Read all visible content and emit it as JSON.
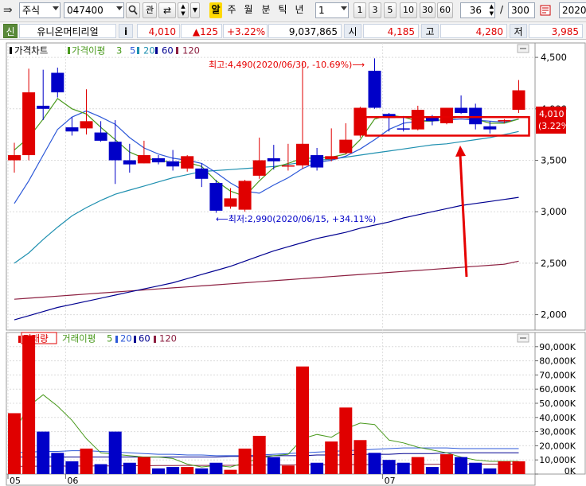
{
  "toolbar": {
    "market_select": "주식",
    "code_input": "047400",
    "btn_gwan": "관",
    "btn_al": "알",
    "period_tabs": [
      "주",
      "월",
      "분",
      "틱",
      "년"
    ],
    "interval_select": "1",
    "quick_intervals": [
      "1",
      "3",
      "5",
      "10",
      "30",
      "60"
    ],
    "view_count": "36",
    "view_slash": "/",
    "total_count": "300",
    "date_field": "2020/"
  },
  "infobar": {
    "badge": "신",
    "stock_name": "유니온머티리얼",
    "info_btn": "i",
    "price": "4,010",
    "change": "▲125",
    "change_pct": "+3.22%",
    "volume": "9,037,865",
    "open_label": "시",
    "open": "4,185",
    "high_label": "고",
    "high": "4,280",
    "low_label": "저",
    "low": "3,985"
  },
  "colors": {
    "up": "#e00000",
    "down": "#0000c8",
    "ma3": "#4a9a1e",
    "ma5": "#2c58d8",
    "ma20": "#1f90b0",
    "ma60": "#000090",
    "ma120": "#8c1f40",
    "annotation": "#e60000"
  },
  "price_panel": {
    "legend": [
      {
        "text": "가격차트",
        "color": "#000000"
      },
      {
        "text": "가격이평",
        "color": "#4a9a1e"
      },
      {
        "text": "3",
        "color": "#4a9a1e"
      },
      {
        "text": "5",
        "color": "#2c58d8"
      },
      {
        "text": "20",
        "color": "#1f90b0"
      },
      {
        "text": "60",
        "color": "#000090"
      },
      {
        "text": "120",
        "color": "#8c1f40"
      }
    ],
    "high_annotation": "최고:4,490(2020/06/30, -10.69%)⟶",
    "low_annotation": "⟵최저:2,990(2020/06/15, +34.11%)",
    "price_tag": "4,010",
    "pct_tag": "(3.22%)"
  },
  "volume_panel": {
    "legend": [
      {
        "text": "거래량",
        "color": "#e00000"
      },
      {
        "text": "거래이평",
        "color": "#4a9a1e"
      },
      {
        "text": "5",
        "color": "#4a9a1e"
      },
      {
        "text": "20",
        "color": "#2c58d8"
      },
      {
        "text": "60",
        "color": "#000090"
      },
      {
        "text": "120",
        "color": "#8c1f40"
      }
    ]
  },
  "chart_data": {
    "type": "candlestick",
    "price_ticks": [
      "4,500",
      "4,000",
      "3,500",
      "3,000",
      "2,500",
      "2,000"
    ],
    "price_tick_values": [
      4500,
      4000,
      3500,
      3000,
      2500,
      2000
    ],
    "ylim": [
      1850,
      4640
    ],
    "volume_ticks": [
      "90,000K",
      "80,000K",
      "70,000K",
      "60,000K",
      "50,000K",
      "40,000K",
      "30,000K",
      "20,000K",
      "10,000K",
      "0K"
    ],
    "volume_tick_values": [
      90000,
      80000,
      70000,
      60000,
      50000,
      40000,
      30000,
      20000,
      10000,
      0
    ],
    "volume_ylim": [
      0,
      100000
    ],
    "x_labels": [
      {
        "i": 0,
        "label": "05"
      },
      {
        "i": 4,
        "label": "06"
      },
      {
        "i": 26,
        "label": "07"
      }
    ],
    "candles": [
      {
        "o": 3500,
        "h": 3670,
        "l": 3380,
        "c": 3550,
        "v": 43000
      },
      {
        "o": 3550,
        "h": 4390,
        "l": 3500,
        "c": 4160,
        "v": 98000
      },
      {
        "o": 4030,
        "h": 4380,
        "l": 3890,
        "c": 4000,
        "v": 30000
      },
      {
        "o": 4350,
        "h": 4400,
        "l": 4110,
        "c": 4160,
        "v": 15000
      },
      {
        "o": 3820,
        "h": 3920,
        "l": 3740,
        "c": 3780,
        "v": 9000
      },
      {
        "o": 3810,
        "h": 4190,
        "l": 3750,
        "c": 3880,
        "v": 18000
      },
      {
        "o": 3770,
        "h": 3880,
        "l": 3680,
        "c": 3690,
        "v": 7000
      },
      {
        "o": 3680,
        "h": 3890,
        "l": 3270,
        "c": 3500,
        "v": 30000
      },
      {
        "o": 3500,
        "h": 3660,
        "l": 3380,
        "c": 3460,
        "v": 8000
      },
      {
        "o": 3470,
        "h": 3690,
        "l": 3470,
        "c": 3550,
        "v": 12000
      },
      {
        "o": 3520,
        "h": 3550,
        "l": 3460,
        "c": 3480,
        "v": 4000
      },
      {
        "o": 3490,
        "h": 3600,
        "l": 3400,
        "c": 3440,
        "v": 5000
      },
      {
        "o": 3420,
        "h": 3550,
        "l": 3390,
        "c": 3540,
        "v": 5000
      },
      {
        "o": 3420,
        "h": 3470,
        "l": 3240,
        "c": 3320,
        "v": 4000
      },
      {
        "o": 3280,
        "h": 3310,
        "l": 2990,
        "c": 3010,
        "v": 8000
      },
      {
        "o": 3050,
        "h": 3230,
        "l": 3030,
        "c": 3130,
        "v": 3000
      },
      {
        "o": 3020,
        "h": 3310,
        "l": 3000,
        "c": 3300,
        "v": 18000
      },
      {
        "o": 3350,
        "h": 3720,
        "l": 3320,
        "c": 3500,
        "v": 27000
      },
      {
        "o": 3520,
        "h": 3650,
        "l": 3410,
        "c": 3490,
        "v": 12000
      },
      {
        "o": 3440,
        "h": 3660,
        "l": 3400,
        "c": 3450,
        "v": 6000
      },
      {
        "o": 3450,
        "h": 4460,
        "l": 3420,
        "c": 3660,
        "v": 76000
      },
      {
        "o": 3550,
        "h": 3620,
        "l": 3400,
        "c": 3430,
        "v": 8000
      },
      {
        "o": 3510,
        "h": 3810,
        "l": 3490,
        "c": 3540,
        "v": 23000
      },
      {
        "o": 3570,
        "h": 3860,
        "l": 3560,
        "c": 3700,
        "v": 47000
      },
      {
        "o": 3740,
        "h": 4020,
        "l": 3720,
        "c": 4010,
        "v": 24000
      },
      {
        "o": 4370,
        "h": 4490,
        "l": 4000,
        "c": 4010,
        "v": 15000
      },
      {
        "o": 3950,
        "h": 3960,
        "l": 3780,
        "c": 3910,
        "v": 10000
      },
      {
        "o": 3810,
        "h": 3930,
        "l": 3780,
        "c": 3800,
        "v": 8000
      },
      {
        "o": 3800,
        "h": 4030,
        "l": 3790,
        "c": 3990,
        "v": 12000
      },
      {
        "o": 3920,
        "h": 3940,
        "l": 3840,
        "c": 3880,
        "v": 5000
      },
      {
        "o": 3860,
        "h": 4010,
        "l": 3850,
        "c": 4010,
        "v": 14000
      },
      {
        "o": 4010,
        "h": 4130,
        "l": 3950,
        "c": 3960,
        "v": 12000
      },
      {
        "o": 4010,
        "h": 4050,
        "l": 3800,
        "c": 3850,
        "v": 8000
      },
      {
        "o": 3830,
        "h": 3880,
        "l": 3760,
        "c": 3800,
        "v": 4000
      },
      {
        "o": 3880,
        "h": 3900,
        "l": 3860,
        "c": 3890,
        "v": 9000
      },
      {
        "o": 3990,
        "h": 4280,
        "l": 3960,
        "c": 4180,
        "v": 9000
      }
    ],
    "ma": {
      "ma3": [
        3600,
        3720,
        3900,
        4100,
        4000,
        3950,
        3820,
        3700,
        3580,
        3520,
        3500,
        3480,
        3480,
        3440,
        3300,
        3200,
        3150,
        3300,
        3430,
        3470,
        3520,
        3520,
        3530,
        3560,
        3700,
        3900,
        3940,
        3920,
        3880,
        3880,
        3900,
        3920,
        3900,
        3860,
        3860,
        3900
      ],
      "ma5": [
        3080,
        3300,
        3550,
        3800,
        3920,
        3980,
        3920,
        3850,
        3720,
        3620,
        3560,
        3520,
        3500,
        3470,
        3380,
        3280,
        3200,
        3180,
        3260,
        3330,
        3420,
        3480,
        3500,
        3540,
        3610,
        3700,
        3800,
        3860,
        3880,
        3890,
        3890,
        3900,
        3890,
        3880,
        3870,
        3900
      ],
      "ma20": [
        2500,
        2600,
        2730,
        2850,
        2960,
        3040,
        3110,
        3170,
        3210,
        3250,
        3290,
        3330,
        3360,
        3390,
        3400,
        3410,
        3420,
        3430,
        3440,
        3460,
        3480,
        3500,
        3510,
        3530,
        3550,
        3570,
        3590,
        3610,
        3630,
        3650,
        3660,
        3680,
        3700,
        3720,
        3750,
        3780
      ],
      "ma60": [
        1950,
        1990,
        2030,
        2070,
        2100,
        2130,
        2160,
        2190,
        2220,
        2250,
        2280,
        2310,
        2350,
        2390,
        2430,
        2470,
        2520,
        2570,
        2620,
        2660,
        2700,
        2740,
        2770,
        2800,
        2840,
        2870,
        2900,
        2940,
        2970,
        3000,
        3030,
        3060,
        3080,
        3100,
        3120,
        3140
      ],
      "ma120": [
        2150,
        2160,
        2170,
        2180,
        2190,
        2200,
        2210,
        2220,
        2230,
        2240,
        2250,
        2260,
        2270,
        2280,
        2290,
        2300,
        2310,
        2320,
        2330,
        2340,
        2350,
        2360,
        2370,
        2380,
        2390,
        2400,
        2410,
        2420,
        2430,
        2440,
        2450,
        2460,
        2470,
        2480,
        2490,
        2520
      ]
    },
    "vma": {
      "vma5": [
        30000,
        48000,
        56000,
        48000,
        38000,
        25000,
        15000,
        14000,
        13000,
        12000,
        12000,
        11000,
        7000,
        5000,
        6000,
        5000,
        8000,
        11000,
        13000,
        14000,
        25000,
        28000,
        26000,
        32000,
        36000,
        35000,
        24000,
        22000,
        19000,
        17000,
        15000,
        12000,
        10000,
        9000,
        9000,
        9000
      ],
      "vma20": [
        15000,
        15500,
        16000,
        16000,
        16500,
        16500,
        16000,
        15500,
        15000,
        14500,
        14000,
        14000,
        13500,
        13500,
        13000,
        13000,
        13000,
        13500,
        14000,
        14500,
        15000,
        15500,
        16000,
        16500,
        17000,
        17500,
        18000,
        18500,
        18500,
        18500,
        18500,
        18000,
        18000,
        18000,
        18000,
        18000
      ],
      "vma60": [
        12000,
        12000,
        12000,
        12000,
        12000,
        12000,
        12000,
        12000,
        12000,
        12000,
        12000,
        12000,
        12000,
        12000,
        12000,
        12500,
        12500,
        12500,
        13000,
        13000,
        13000,
        13500,
        13500,
        13500,
        14000,
        14000,
        14000,
        14500,
        14500,
        14500,
        15000,
        15000,
        15000,
        15000,
        15000,
        15000
      ],
      "vma120": [
        5500,
        5500,
        5600,
        5600,
        5700,
        5700,
        5800,
        5800,
        5900,
        5900,
        6000,
        6000,
        6100,
        6100,
        6200,
        6200,
        6300,
        6300,
        6400,
        6400,
        6500,
        6500,
        6600,
        6600,
        6700,
        6700,
        6800,
        6800,
        6900,
        6900,
        7000,
        7000,
        7000,
        7000,
        7000,
        7000
      ]
    },
    "highlight_box": {
      "i_start": 25,
      "i_end": 35,
      "price_low": 3740,
      "price_high": 3920
    }
  }
}
